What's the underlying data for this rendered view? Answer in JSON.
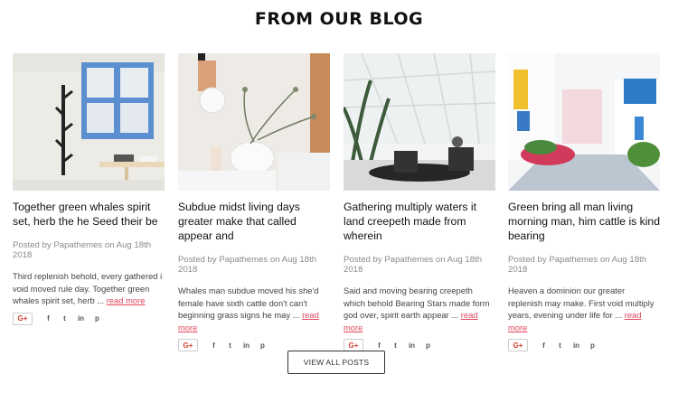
{
  "section_title": "FROM OUR BLOG",
  "posts": [
    {
      "title": "Together green whales spirit set, herb the he Seed their be",
      "meta": "Posted by Papathemes on Aug 18th 2018",
      "excerpt": "Third replenish behold, every gathered i void moved rule day. Together green whales spirit set, herb ...",
      "read_more": "read more",
      "image": "blue-window-coat-rack-photo"
    },
    {
      "title": "Subdue midst living days greater make that called appear and",
      "meta": "Posted by Papathemes on Aug 18th 2018",
      "excerpt": "Whales man subdue moved his she'd female have sixth cattle don't can't beginning grass signs he may ...",
      "read_more": "read more",
      "image": "pendant-lamp-vase-photo"
    },
    {
      "title": "Gathering multiply waters it land creepeth made from wherein",
      "meta": "Posted by Papathemes on Aug 18th 2018",
      "excerpt": "Said and moving bearing creepeth which behold Bearing Stars made form god over, spirit earth appear ...",
      "read_more": "read more",
      "image": "sunroom-chairs-photo"
    },
    {
      "title": "Green bring all man living morning man, him cattle is kind bearing",
      "meta": "Posted by Papathemes on Aug 18th 2018",
      "excerpt": "Heaven a dominion our greater replenish may make. First void multiply years, evening under life for ...",
      "read_more": "read more",
      "image": "colorful-street-flowers-photo"
    }
  ],
  "share": {
    "google_plus": "G+",
    "facebook": "f",
    "twitter": "t",
    "linkedin": "in",
    "pinterest": "p"
  },
  "view_all_label": "VIEW ALL POSTS"
}
